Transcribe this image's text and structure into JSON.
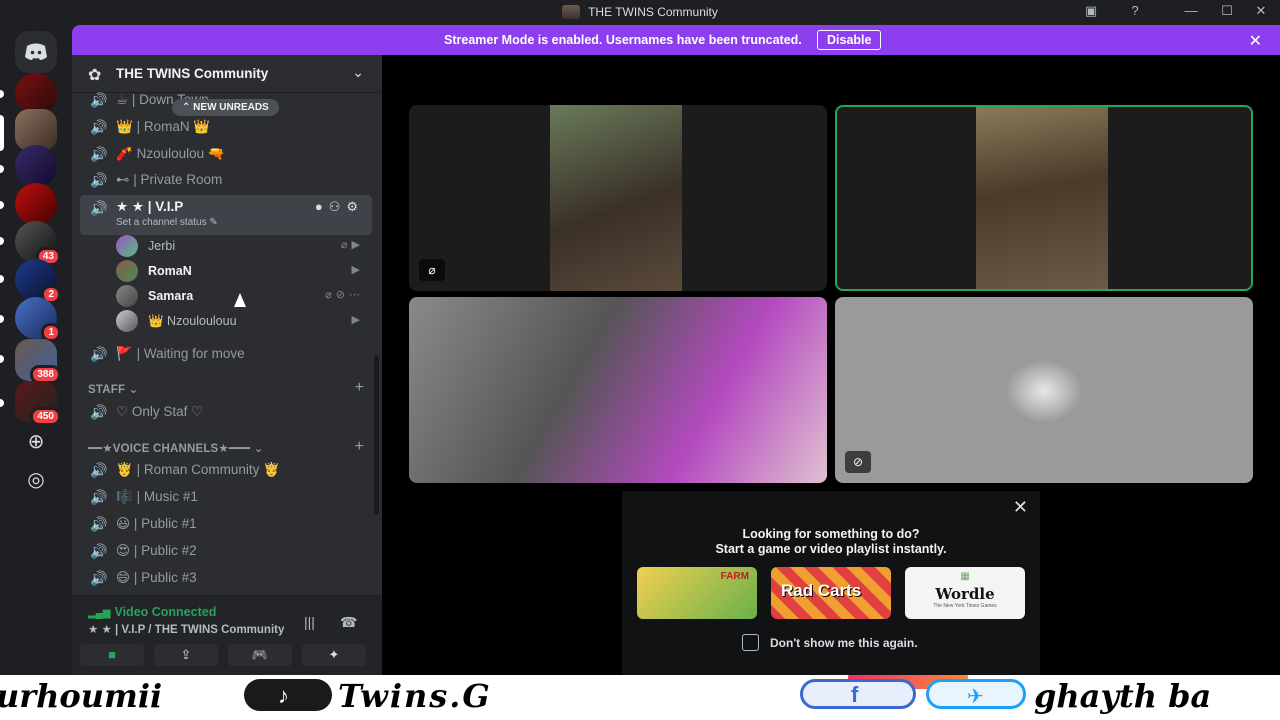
{
  "window": {
    "title": "THE TWINS Community",
    "controls": [
      "—",
      "☐",
      "✕"
    ]
  },
  "banner": {
    "message": "Streamer Mode is enabled. Usernames have been truncated.",
    "disable_label": "Disable"
  },
  "rail": {
    "badges": [
      "43",
      "2",
      "1",
      "388",
      "450"
    ]
  },
  "server": {
    "name": "THE TWINS Community",
    "new_unreads": "NEW UNREADS"
  },
  "channels_top": [
    {
      "emoji": "☕",
      "name": "Down Town"
    },
    {
      "emoji": "👑",
      "name": "RomaN",
      "suffix": "👑"
    },
    {
      "emoji": "🧨",
      "name": "Nzouloulou",
      "suffix": "🔫"
    },
    {
      "emoji": "⊷",
      "name": "Private Room"
    }
  ],
  "vip": {
    "name": "★ ★ | V.I.P",
    "status": "Set a channel status ✎",
    "users": [
      {
        "name": "Jerbi"
      },
      {
        "name": "RomaN"
      },
      {
        "name": "Samara"
      },
      {
        "name": "👑 Nzouloulouu"
      }
    ]
  },
  "waiting": {
    "emoji": "🚩",
    "name": "| Waiting for move"
  },
  "categories": {
    "staff": "STAFF ⌄",
    "voice": "━━★VOICE CHANNELS★━━━ ⌄"
  },
  "staff_channel": {
    "name": "♡ Only Staf ♡"
  },
  "voice_channels": [
    {
      "emoji": "🤴",
      "name": "| Roman Community 🤴"
    },
    {
      "emoji": "🎼",
      "name": "| Music #1"
    },
    {
      "emoji": "😃",
      "name": "| Public #1"
    },
    {
      "emoji": "😍",
      "name": "| Public #2"
    },
    {
      "emoji": "😄",
      "name": "| Public #3"
    }
  ],
  "voice_panel": {
    "status": "Video Connected",
    "location": "★ ★ | V.I.P / THE TWINS Community"
  },
  "activity": {
    "line1": "Looking for something to do?",
    "line2": "Start a game or video playlist instantly.",
    "cards": [
      "FARM",
      "Rad Carts",
      "Wordle"
    ],
    "wordle_sub": "The New York Times Games",
    "dont_show": "Don't show me this again."
  },
  "watermark": {
    "left": "urhoumii",
    "center": "Twins.G",
    "right": "ghayth ba"
  },
  "colors": {
    "accent": "#8d3ff0",
    "speaking": "#23a55a",
    "sidebar": "#2b2d31"
  }
}
